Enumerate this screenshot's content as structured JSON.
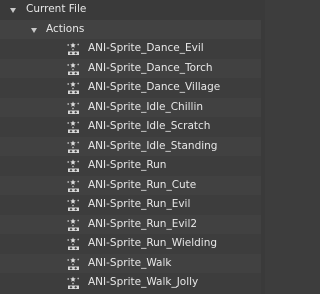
{
  "outliner": {
    "file_label": "Current File",
    "actions_label": "Actions",
    "items": [
      "ANI-Sprite_Dance_Evil",
      "ANI-Sprite_Dance_Torch",
      "ANI-Sprite_Dance_Village",
      "ANI-Sprite_Idle_Chillin",
      "ANI-Sprite_Idle_Scratch",
      "ANI-Sprite_Idle_Standing",
      "ANI-Sprite_Run",
      "ANI-Sprite_Run_Cute",
      "ANI-Sprite_Run_Evil",
      "ANI-Sprite_Run_Evil2",
      "ANI-Sprite_Run_Wielding",
      "ANI-Sprite_Walk",
      "ANI-Sprite_Walk_Jolly"
    ],
    "item_icon": "action-icon"
  },
  "colors": {
    "background": "#3d3d3d",
    "text": "#e8e8e8"
  }
}
